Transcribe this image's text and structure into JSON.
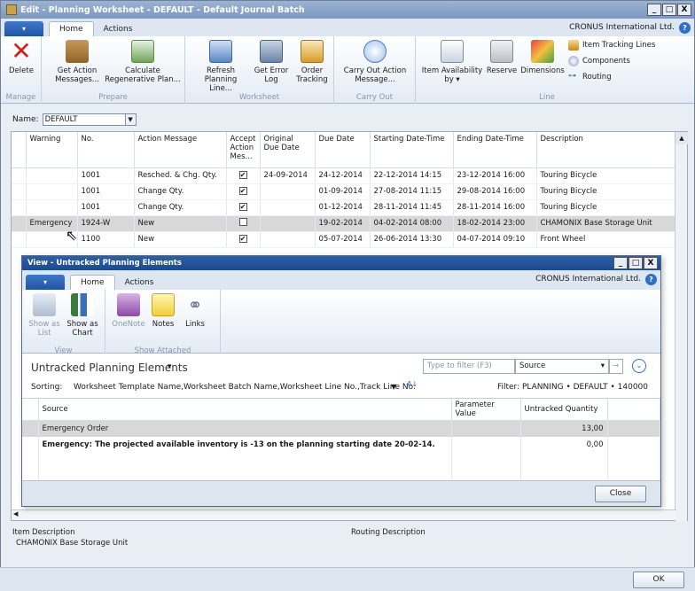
{
  "main": {
    "title": "Edit - Planning Worksheet - DEFAULT - Default Journal Batch",
    "window_buttons": [
      "_",
      "□",
      "X"
    ],
    "tabs": [
      "Home",
      "Actions"
    ],
    "company": "CRONUS International Ltd.",
    "help": "?",
    "ribbon": {
      "groups": {
        "manage": "Manage",
        "prepare": "Prepare",
        "worksheet": "Worksheet",
        "carry_out": "Carry Out",
        "line": "Line"
      },
      "buttons": {
        "delete": "Delete",
        "get_action_messages": "Get Action Messages...",
        "calc_regen_plan": "Calculate Regenerative Plan...",
        "refresh_planning_line": "Refresh Planning Line...",
        "get_error_log": "Get Error Log",
        "order_tracking": "Order Tracking",
        "carry_out_action_message": "Carry Out Action Message...",
        "item_availability_by": "Item Availability by",
        "reserve": "Reserve",
        "dimensions": "Dimensions",
        "item_tracking_lines": "Item Tracking Lines",
        "components": "Components",
        "routing": "Routing"
      }
    },
    "name_label": "Name:",
    "name_value": "DEFAULT",
    "columns": [
      "Warning",
      "No.",
      "Action Message",
      "Accept Action Mes...",
      "Original Due Date",
      "Due Date",
      "Starting Date-Time",
      "Ending Date-Time",
      "Description"
    ],
    "rows": [
      {
        "warning": "",
        "no": "1001",
        "action": "Resched. & Chg. Qty.",
        "accept": true,
        "orig_due": "24-09-2014",
        "due": "24-12-2014",
        "start": "22-12-2014 14:15",
        "end": "23-12-2014 16:00",
        "desc": "Touring Bicycle"
      },
      {
        "warning": "",
        "no": "1001",
        "action": "Change Qty.",
        "accept": true,
        "orig_due": "",
        "due": "01-09-2014",
        "start": "27-08-2014 11:15",
        "end": "29-08-2014 16:00",
        "desc": "Touring Bicycle"
      },
      {
        "warning": "",
        "no": "1001",
        "action": "Change Qty.",
        "accept": true,
        "orig_due": "",
        "due": "01-12-2014",
        "start": "28-11-2014 11:45",
        "end": "28-11-2014 16:00",
        "desc": "Touring Bicycle"
      },
      {
        "warning": "Emergency",
        "no": "1924-W",
        "action": "New",
        "accept": false,
        "orig_due": "",
        "due": "19-02-2014",
        "start": "04-02-2014 08:00",
        "end": "18-02-2014 23:00",
        "desc": "CHAMONIX Base Storage Unit"
      },
      {
        "warning": "",
        "no": "1100",
        "action": "New",
        "accept": true,
        "orig_due": "",
        "due": "05-07-2014",
        "start": "26-06-2014 13:30",
        "end": "04-07-2014 09:10",
        "desc": "Front Wheel"
      }
    ],
    "item_description_label": "Item Description",
    "item_description_value": "CHAMONIX Base Storage Unit",
    "routing_description_label": "Routing Description",
    "ok": "OK"
  },
  "child": {
    "title": "View - Untracked Planning Elements",
    "window_buttons": [
      "_",
      "□",
      "X"
    ],
    "tabs": [
      "Home",
      "Actions"
    ],
    "company": "CRONUS International Ltd.",
    "help": "?",
    "ribbon": {
      "groups": {
        "view": "View",
        "show_attached": "Show Attached"
      },
      "buttons": {
        "show_as_list": "Show as List",
        "show_as_chart": "Show as Chart",
        "onenote": "OneNote",
        "notes": "Notes",
        "links": "Links"
      }
    },
    "page_title": "Untracked Planning Elements",
    "filter_placeholder": "Type to filter (F3)",
    "filter_field": "Source",
    "sorting_label": "Sorting:",
    "sorting_value": "Worksheet Template Name,Worksheet Batch Name,Worksheet Line No.,Track Line No.",
    "filter_summary": "Filter: PLANNING • DEFAULT • 140000",
    "columns": [
      "Source",
      "Parameter Value",
      "Untracked Quantity"
    ],
    "rows": [
      {
        "source": "Emergency Order",
        "param": "",
        "qty": "13,00"
      },
      {
        "source": "Emergency: The projected available inventory is -13 on the planning starting date 20-02-14.",
        "param": "",
        "qty": "0,00"
      }
    ],
    "close": "Close"
  },
  "colors": {
    "accent": "#2f6fc9",
    "selected_row": "#d8d8d8",
    "titlebar_active": "#1d4a8e"
  }
}
